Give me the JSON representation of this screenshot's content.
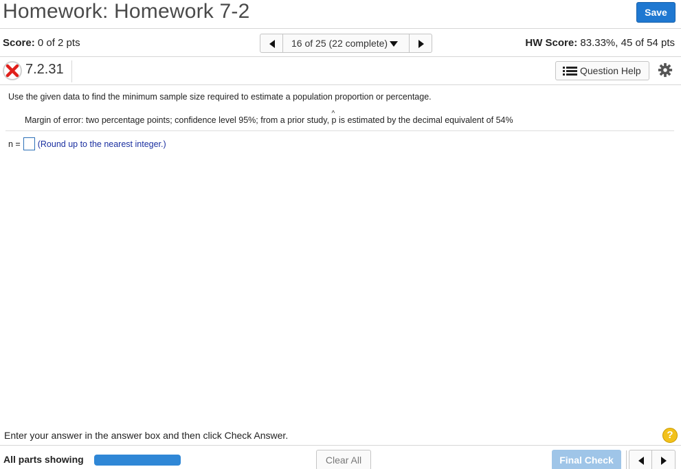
{
  "header": {
    "title": "Homework: Homework 7-2",
    "save_label": "Save"
  },
  "scorebar": {
    "score_label": "Score:",
    "score_value": "0 of 2 pts",
    "nav_text": "16 of 25 (22 complete)",
    "hw_label": "HW Score:",
    "hw_value": "83.33%, 45 of 54 pts"
  },
  "question": {
    "number": "7.2.31",
    "help_label": "Question Help",
    "status": "incorrect"
  },
  "content": {
    "instructions": "Use the given data to find the minimum sample size required to estimate a population proportion or percentage.",
    "margin_text_before": "Margin of error: two percentage points; confidence level 95%; from a prior study,",
    "p_symbol": "p",
    "hat_symbol": "^",
    "margin_text_after": "is estimated by the decimal equivalent of 54%",
    "n_label": "n =",
    "n_value": "",
    "round_hint": "(Round up to the nearest integer.)"
  },
  "footer": {
    "enter_text": "Enter your answer in the answer box and then click Check Answer.",
    "help_glyph": "?",
    "all_parts": "All parts showing",
    "clear_label": "Clear All",
    "final_label": "Final Check"
  },
  "colors": {
    "primary": "#1f78d1",
    "progress": "#2f87d6",
    "final_disabled": "#9fc5e8",
    "incorrect": "#e0201b",
    "help_yellow": "#f2c11b"
  },
  "icons": [
    "x-mark-icon",
    "list-icon",
    "gear-icon",
    "help-icon",
    "triangle-left-icon",
    "triangle-right-icon",
    "triangle-down-icon"
  ]
}
